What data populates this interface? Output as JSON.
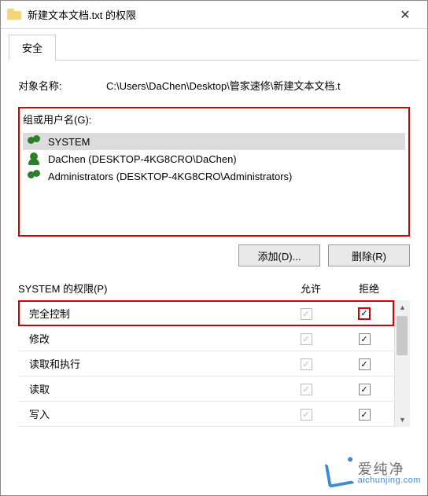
{
  "window": {
    "title": "新建文本文档.txt 的权限"
  },
  "tab": {
    "security": "安全"
  },
  "object": {
    "label": "对象名称:",
    "path": "C:\\Users\\DaChen\\Desktop\\管家速修\\新建文本文档.t"
  },
  "groupbox": {
    "label": "组或用户名(G):"
  },
  "users": [
    {
      "name": "SYSTEM",
      "type": "group",
      "selected": true
    },
    {
      "name": "DaChen (DESKTOP-4KG8CRO\\DaChen)",
      "type": "single",
      "selected": false
    },
    {
      "name": "Administrators (DESKTOP-4KG8CRO\\Administrators)",
      "type": "group",
      "selected": false
    }
  ],
  "buttons": {
    "add": "添加(D)...",
    "remove": "删除(R)"
  },
  "perm": {
    "header_label": "SYSTEM 的权限(P)",
    "allow": "允许",
    "deny": "拒绝",
    "rows": [
      {
        "name": "完全控制",
        "allow": true,
        "deny": true,
        "highlight": true,
        "deny_highlight": true
      },
      {
        "name": "修改",
        "allow": true,
        "deny": true
      },
      {
        "name": "读取和执行",
        "allow": true,
        "deny": true
      },
      {
        "name": "读取",
        "allow": true,
        "deny": true
      },
      {
        "name": "写入",
        "allow": true,
        "deny": true
      }
    ]
  },
  "watermark": {
    "cn": "爱纯净",
    "en": "aichunjing.com"
  }
}
